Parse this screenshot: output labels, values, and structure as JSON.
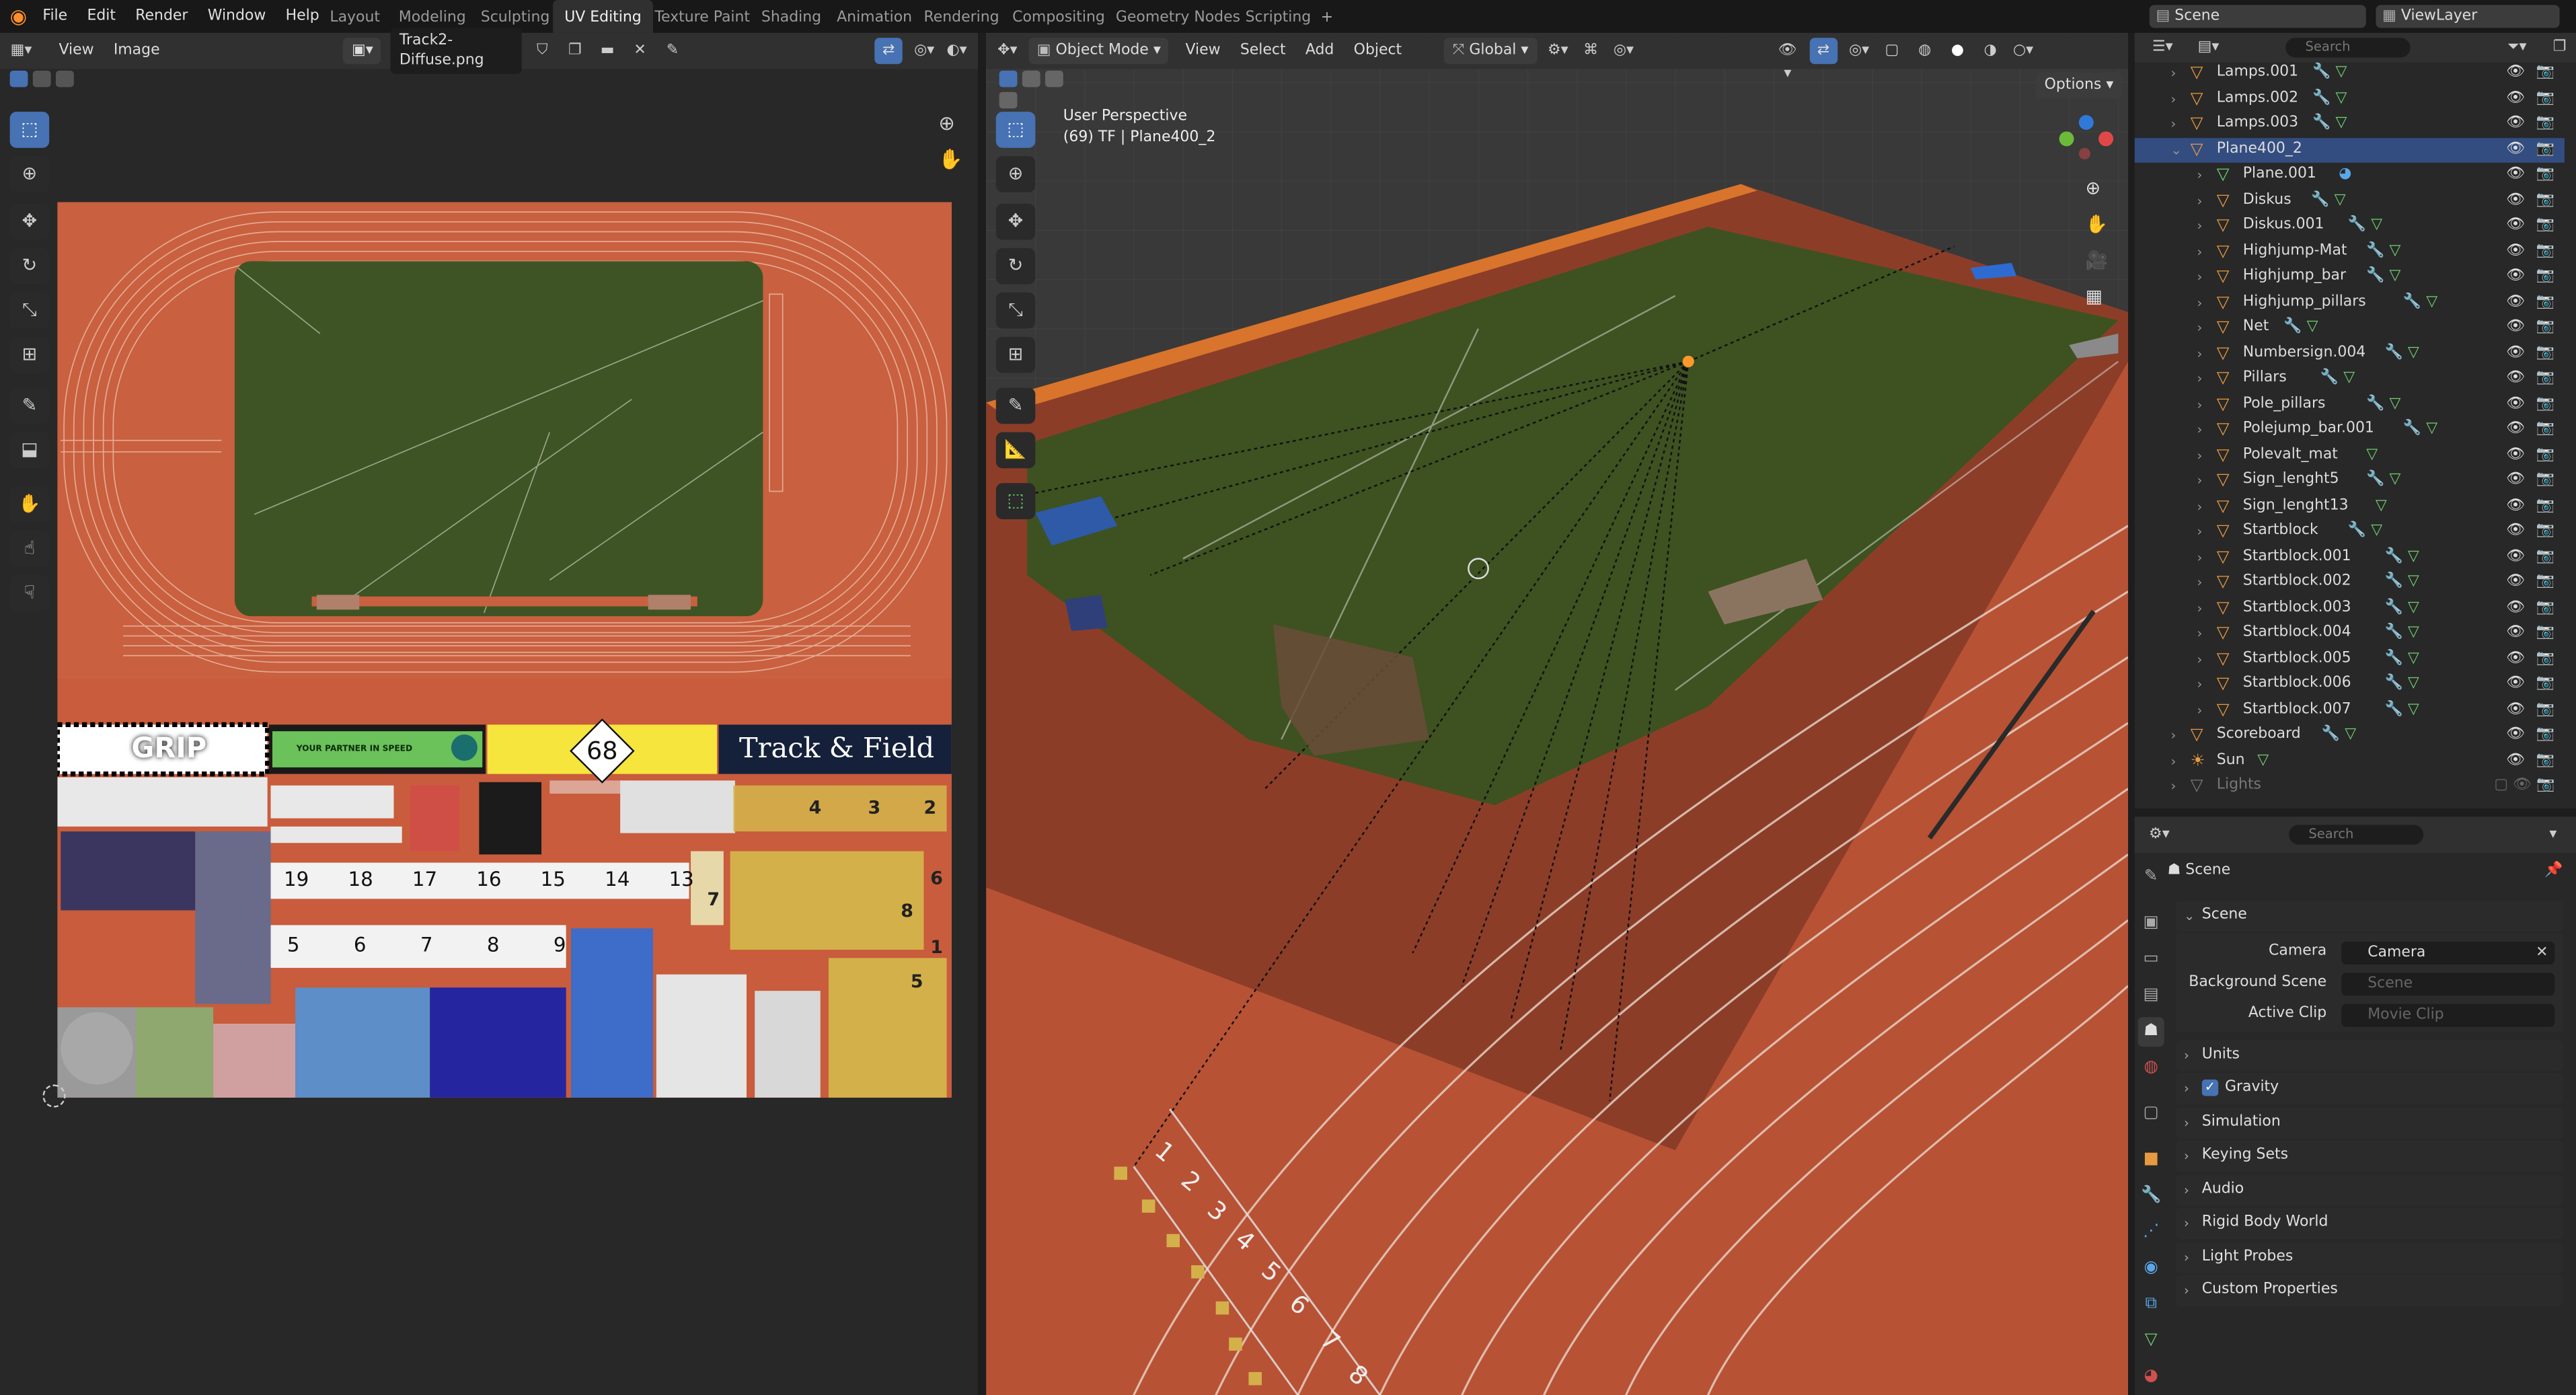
{
  "menubar": {
    "items": [
      "File",
      "Edit",
      "Render",
      "Window",
      "Help"
    ]
  },
  "workspaces": [
    "Layout",
    "Modeling",
    "Sculpting",
    "UV Editing",
    "Texture Paint",
    "Shading",
    "Animation",
    "Rendering",
    "Compositing",
    "Geometry Nodes",
    "Scripting"
  ],
  "active_workspace": "UV Editing",
  "scene_selector": {
    "scene": "Scene",
    "view_layer": "ViewLayer"
  },
  "uv_editor": {
    "menus": [
      "View",
      "Image"
    ],
    "image_name": "Track2-Diffuse.png",
    "texture_labels": {
      "grip": "GRIP",
      "partner": "YOUR PARTNER IN SPEED",
      "badge": "68",
      "track_field": "Track & Field",
      "ruler_top": [
        "19",
        "18",
        "17",
        "16",
        "15",
        "14",
        "13"
      ],
      "ruler_bottom": [
        "5",
        "6",
        "7",
        "8",
        "9"
      ],
      "lane_numbers": [
        "4",
        "3",
        "2",
        "7",
        "6",
        "8",
        "1",
        "5"
      ]
    }
  },
  "viewport": {
    "mode": "Object Mode",
    "menus": [
      "View",
      "Select",
      "Add",
      "Object"
    ],
    "orientation": "Global",
    "options_label": "Options",
    "overlay_title": "User Perspective",
    "overlay_sub": "(69) TF | Plane400_2",
    "lane_numbers": [
      "1",
      "2",
      "3",
      "4",
      "5",
      "6",
      "7",
      "8"
    ]
  },
  "outliner": {
    "search_placeholder": "Search",
    "rows": [
      {
        "name": "Lamps.001",
        "depth": 0,
        "mods": 2,
        "selected": false,
        "vis": true
      },
      {
        "name": "Lamps.002",
        "depth": 0,
        "mods": 2,
        "selected": false,
        "vis": true
      },
      {
        "name": "Lamps.003",
        "depth": 0,
        "mods": 2,
        "selected": false,
        "vis": true
      },
      {
        "name": "Plane400_2",
        "depth": 0,
        "mods": 0,
        "selected": true,
        "vis": true
      },
      {
        "name": "Plane.001",
        "depth": 1,
        "mods": 1,
        "selected": false,
        "vis": true
      },
      {
        "name": "Diskus",
        "depth": 1,
        "mods": 2,
        "selected": false,
        "vis": true
      },
      {
        "name": "Diskus.001",
        "depth": 1,
        "mods": 2,
        "selected": false,
        "vis": true
      },
      {
        "name": "Highjump-Mat",
        "depth": 1,
        "mods": 2,
        "selected": false,
        "vis": true
      },
      {
        "name": "Highjump_bar",
        "depth": 1,
        "mods": 2,
        "selected": false,
        "vis": true
      },
      {
        "name": "Highjump_pillars",
        "depth": 1,
        "mods": 2,
        "selected": false,
        "vis": true
      },
      {
        "name": "Net",
        "depth": 1,
        "mods": 2,
        "selected": false,
        "vis": true
      },
      {
        "name": "Numbersign.004",
        "depth": 1,
        "mods": 2,
        "selected": false,
        "vis": true
      },
      {
        "name": "Pillars",
        "depth": 1,
        "mods": 2,
        "selected": false,
        "vis": true
      },
      {
        "name": "Pole_pillars",
        "depth": 1,
        "mods": 2,
        "selected": false,
        "vis": true
      },
      {
        "name": "Polejump_bar.001",
        "depth": 1,
        "mods": 2,
        "selected": false,
        "vis": true
      },
      {
        "name": "Polevalt_mat",
        "depth": 1,
        "mods": 1,
        "selected": false,
        "vis": true
      },
      {
        "name": "Sign_lenght5",
        "depth": 1,
        "mods": 2,
        "selected": false,
        "vis": true
      },
      {
        "name": "Sign_lenght13",
        "depth": 1,
        "mods": 1,
        "selected": false,
        "vis": true
      },
      {
        "name": "Startblock",
        "depth": 1,
        "mods": 2,
        "selected": false,
        "vis": true
      },
      {
        "name": "Startblock.001",
        "depth": 1,
        "mods": 2,
        "selected": false,
        "vis": true
      },
      {
        "name": "Startblock.002",
        "depth": 1,
        "mods": 2,
        "selected": false,
        "vis": true
      },
      {
        "name": "Startblock.003",
        "depth": 1,
        "mods": 2,
        "selected": false,
        "vis": true
      },
      {
        "name": "Startblock.004",
        "depth": 1,
        "mods": 2,
        "selected": false,
        "vis": true
      },
      {
        "name": "Startblock.005",
        "depth": 1,
        "mods": 2,
        "selected": false,
        "vis": true
      },
      {
        "name": "Startblock.006",
        "depth": 1,
        "mods": 2,
        "selected": false,
        "vis": true
      },
      {
        "name": "Startblock.007",
        "depth": 1,
        "mods": 2,
        "selected": false,
        "vis": true
      },
      {
        "name": "Scoreboard",
        "depth": 0,
        "mods": 2,
        "selected": false,
        "vis": true
      },
      {
        "name": "Sun",
        "depth": 0,
        "mods": 1,
        "selected": false,
        "vis": true
      },
      {
        "name": "Lights",
        "depth": 0,
        "mods": 0,
        "selected": false,
        "vis": false
      }
    ]
  },
  "properties": {
    "search_placeholder": "Search",
    "context": "Scene",
    "panel": {
      "title": "Scene",
      "camera_label": "Camera",
      "camera_value": "Camera",
      "bg_label": "Background Scene",
      "bg_placeholder": "Scene",
      "clip_label": "Active Clip",
      "clip_placeholder": "Movie Clip"
    },
    "sections": [
      "Units",
      "Gravity",
      "Simulation",
      "Keying Sets",
      "Audio",
      "Rigid Body World",
      "Light Probes",
      "Custom Properties"
    ]
  },
  "colors": {
    "accent": "#4772b3",
    "track": "#c65a3a",
    "grass": "#3d5220",
    "selected_row": "#334d80",
    "object_orange": "#e89a40"
  }
}
